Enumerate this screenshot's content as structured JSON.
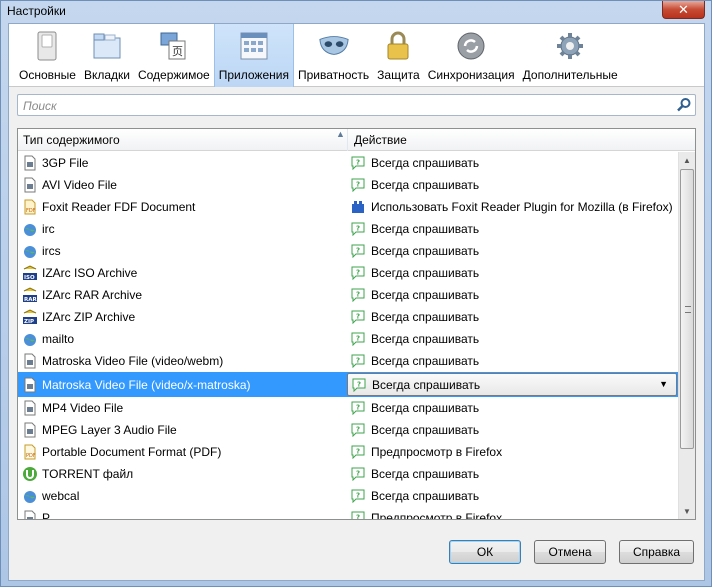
{
  "window": {
    "title": "Настройки",
    "close_glyph": "✕"
  },
  "toolbar": {
    "items": [
      {
        "label": "Основные",
        "icon": "switch-icon"
      },
      {
        "label": "Вкладки",
        "icon": "tabs-icon"
      },
      {
        "label": "Содержимое",
        "icon": "content-icon"
      },
      {
        "label": "Приложения",
        "icon": "applications-icon",
        "active": true
      },
      {
        "label": "Приватность",
        "icon": "mask-icon"
      },
      {
        "label": "Защита",
        "icon": "padlock-icon"
      },
      {
        "label": "Синхронизация",
        "icon": "sync-icon"
      },
      {
        "label": "Дополнительные",
        "icon": "gear-icon"
      }
    ]
  },
  "search": {
    "placeholder": "Поиск"
  },
  "table": {
    "col_type": "Тип содержимого",
    "col_action": "Действие",
    "rows": [
      {
        "type": "3GP File",
        "action": "Всегда спрашивать",
        "icon": "file-icon"
      },
      {
        "type": "AVI Video File",
        "action": "Всегда спрашивать",
        "icon": "file-icon"
      },
      {
        "type": "Foxit Reader FDF Document",
        "action": "Использовать Foxit Reader Plugin for Mozilla (в Firefox)",
        "icon": "fdf-icon",
        "action_icon": "plugin-icon"
      },
      {
        "type": "irc",
        "action": "Всегда спрашивать",
        "icon": "globe-icon"
      },
      {
        "type": "ircs",
        "action": "Всегда спрашивать",
        "icon": "globe-icon"
      },
      {
        "type": "IZArc ISO Archive",
        "action": "Всегда спрашивать",
        "icon": "iso-icon"
      },
      {
        "type": "IZArc RAR Archive",
        "action": "Всегда спрашивать",
        "icon": "rar-icon"
      },
      {
        "type": "IZArc ZIP Archive",
        "action": "Всегда спрашивать",
        "icon": "zip-icon"
      },
      {
        "type": "mailto",
        "action": "Всегда спрашивать",
        "icon": "globe-icon"
      },
      {
        "type": "Matroska Video File (video/webm)",
        "action": "Всегда спрашивать",
        "icon": "file-icon"
      },
      {
        "type": "Matroska Video File (video/x-matroska)",
        "action": "Всегда спрашивать",
        "icon": "file-icon",
        "selected": true
      },
      {
        "type": "MP4 Video File",
        "action": "Всегда спрашивать",
        "icon": "file-icon"
      },
      {
        "type": "MPEG Layer 3 Audio File",
        "action": "Всегда спрашивать",
        "icon": "file-icon"
      },
      {
        "type": "Portable Document Format (PDF)",
        "action": "Предпросмотр в Firefox",
        "icon": "pdf-icon"
      },
      {
        "type": "TORRENT файл",
        "action": "Всегда спрашивать",
        "icon": "torrent-icon"
      },
      {
        "type": "webcal",
        "action": "Всегда спрашивать",
        "icon": "globe-icon"
      },
      {
        "type": "P...",
        "action": "Предпросмотр в Firefox",
        "icon": "file-icon"
      }
    ]
  },
  "buttons": {
    "ok": "ОК",
    "cancel": "Отмена",
    "help": "Справка"
  },
  "colors": {
    "selection": "#3399ff",
    "ask_icon": "#3fa34d"
  }
}
